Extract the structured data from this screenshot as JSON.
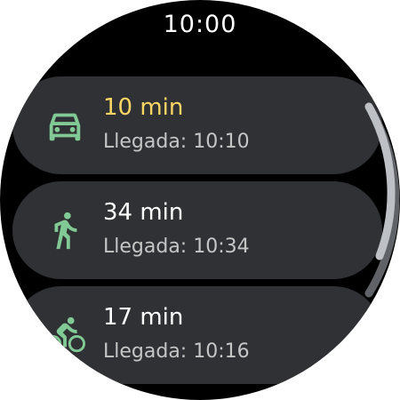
{
  "status_bar": {
    "time": "10:00"
  },
  "routes": [
    {
      "mode_icon": "car-icon",
      "duration": "10 min",
      "arrival": "Llegada: 10:10",
      "highlighted": true
    },
    {
      "mode_icon": "walk-icon",
      "duration": "34 min",
      "arrival": "Llegada: 10:34",
      "highlighted": false
    },
    {
      "mode_icon": "bike-icon",
      "duration": "17 min",
      "arrival": "Llegada: 10:16",
      "highlighted": false
    }
  ],
  "colors": {
    "background": "#000000",
    "card": "#303134",
    "icon_accent": "#81c995",
    "highlight_text": "#fdd663",
    "secondary_text": "#c4c7c5",
    "scrollbar_track": "#5f6368",
    "scrollbar_thumb": "#bdc1c6"
  }
}
